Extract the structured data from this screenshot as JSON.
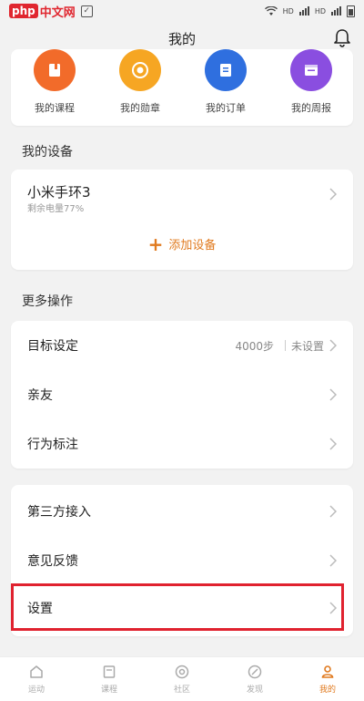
{
  "watermark": {
    "badge": "php",
    "text": "中文网"
  },
  "header": {
    "title": "我的"
  },
  "quick_actions": [
    {
      "label": "我的课程",
      "icon": "course-icon",
      "color": "#f26b2a"
    },
    {
      "label": "我的勋章",
      "icon": "medal-icon",
      "color": "#f6a623"
    },
    {
      "label": "我的订单",
      "icon": "order-icon",
      "color": "#2f6fdf"
    },
    {
      "label": "我的周报",
      "icon": "weekly-report-icon",
      "color": "#8a4ee0"
    }
  ],
  "devices": {
    "section_title": "我的设备",
    "device_name": "小米手环3",
    "battery_text": "剩余电量77%",
    "add_label": "添加设备"
  },
  "more": {
    "section_title": "更多操作",
    "goal": {
      "label": "目标设定",
      "value": "4000步",
      "status": "未设置"
    },
    "friends": {
      "label": "亲友"
    },
    "behavior": {
      "label": "行为标注"
    }
  },
  "misc": {
    "third_party": {
      "label": "第三方接入"
    },
    "feedback": {
      "label": "意见反馈"
    },
    "settings": {
      "label": "设置"
    }
  },
  "tabs": [
    {
      "label": "运动",
      "icon": "home-icon"
    },
    {
      "label": "课程",
      "icon": "course-tab-icon"
    },
    {
      "label": "社区",
      "icon": "community-icon"
    },
    {
      "label": "发现",
      "icon": "discover-icon"
    },
    {
      "label": "我的",
      "icon": "profile-icon",
      "active": true
    }
  ],
  "colors": {
    "accent": "#e07a1f",
    "highlight": "#e0222f"
  }
}
